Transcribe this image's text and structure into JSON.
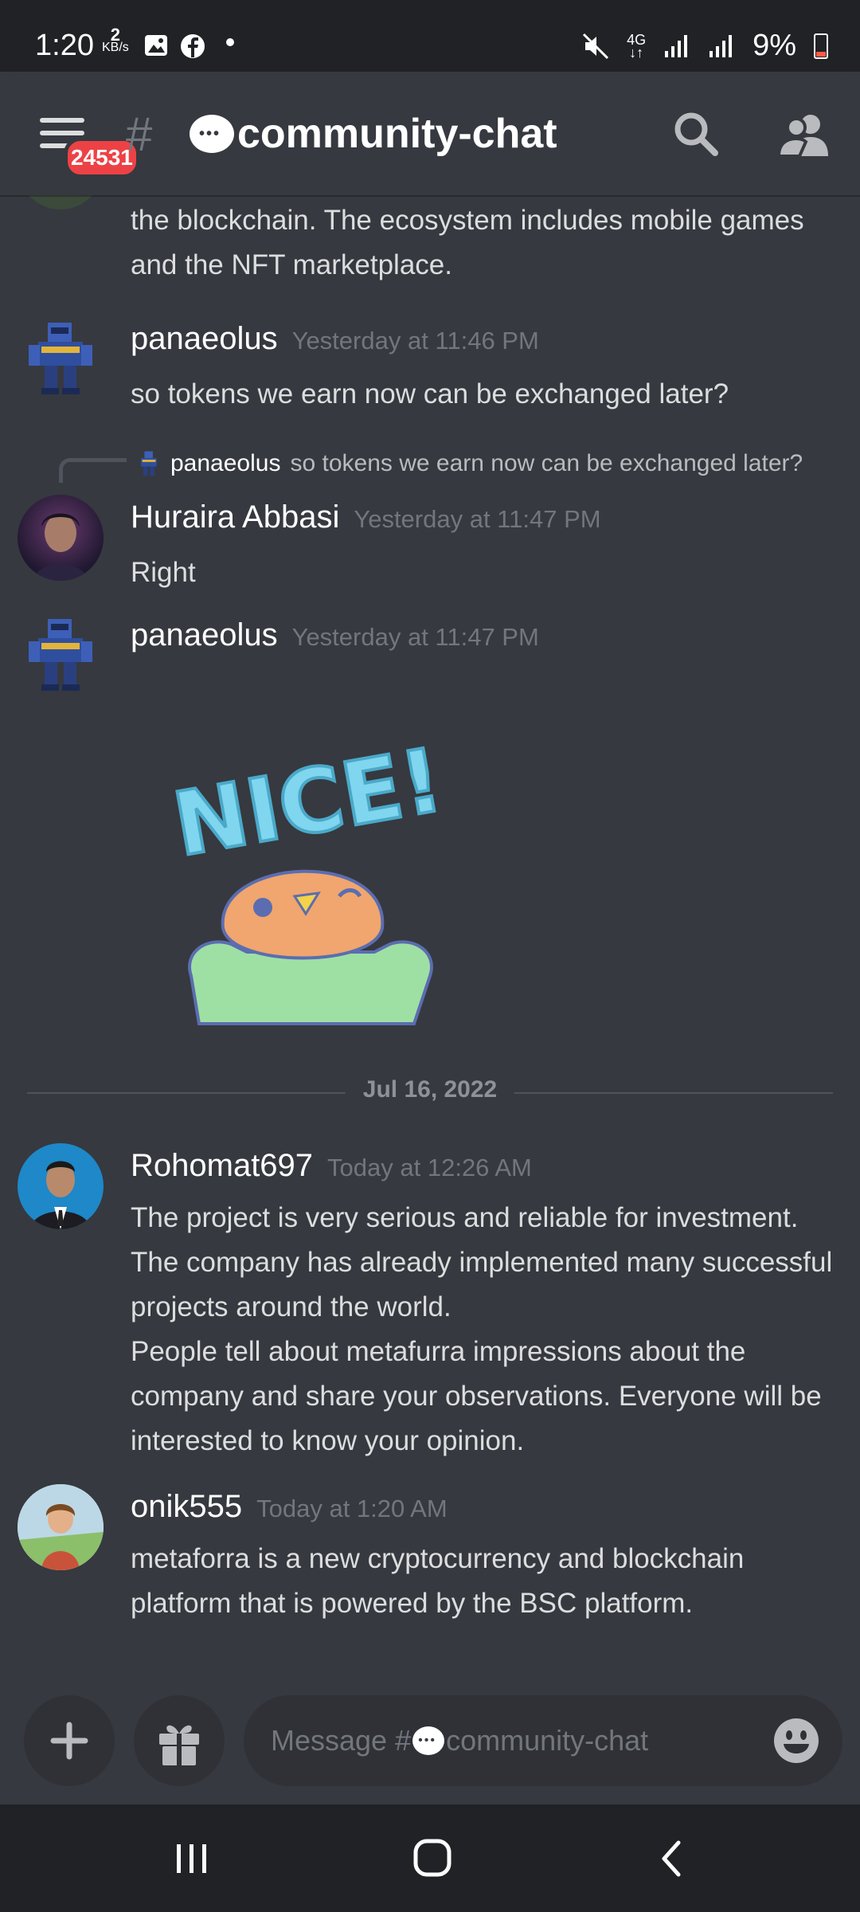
{
  "status_bar": {
    "time": "1:20",
    "data_speed_value": "2",
    "data_speed_unit": "KB/s",
    "network": "4G",
    "battery": "9%"
  },
  "header": {
    "channel_name": "community-chat",
    "notification_badge": "24531",
    "icons": [
      "menu-icon",
      "search-icon",
      "members-icon"
    ]
  },
  "messages": [
    {
      "text": "METAFORRA is a Play & Earn ecosystem that lives on the blockchain. The ecosystem includes mobile games and the NFT marketplace."
    },
    {
      "author": "panaeolus",
      "timestamp": "Yesterday at 11:46 PM",
      "text": "so tokens we earn now can be exchanged later?"
    },
    {
      "reply_to_author": "panaeolus",
      "reply_to_text": "so tokens we earn now can be exchanged later?",
      "author": "Huraira Abbasi",
      "timestamp": "Yesterday at 11:47 PM",
      "text": "Right"
    },
    {
      "author": "panaeolus",
      "timestamp": "Yesterday at 11:47 PM",
      "sticker": "NICE!"
    },
    {
      "author": "Rohomat697",
      "timestamp": "Today at 12:26 AM",
      "text": "The project is very serious and reliable for investment. The company has already implemented many successful projects around the world.\nPeople tell about metafurra impressions about the company and share your observations. Everyone will be interested to know your opinion."
    },
    {
      "author": "onik555",
      "timestamp": "Today at 1:20 AM",
      "text": "metaforra is a new cryptocurrency and blockchain platform that is powered by the BSC platform."
    }
  ],
  "date_divider": "Jul 16, 2022",
  "composer": {
    "placeholder_prefix": "Message #",
    "placeholder_channel": "community-chat"
  },
  "colors": {
    "background": "#36393f",
    "badge": "#ed4245",
    "text": "#dcddde",
    "muted": "#72767d"
  }
}
